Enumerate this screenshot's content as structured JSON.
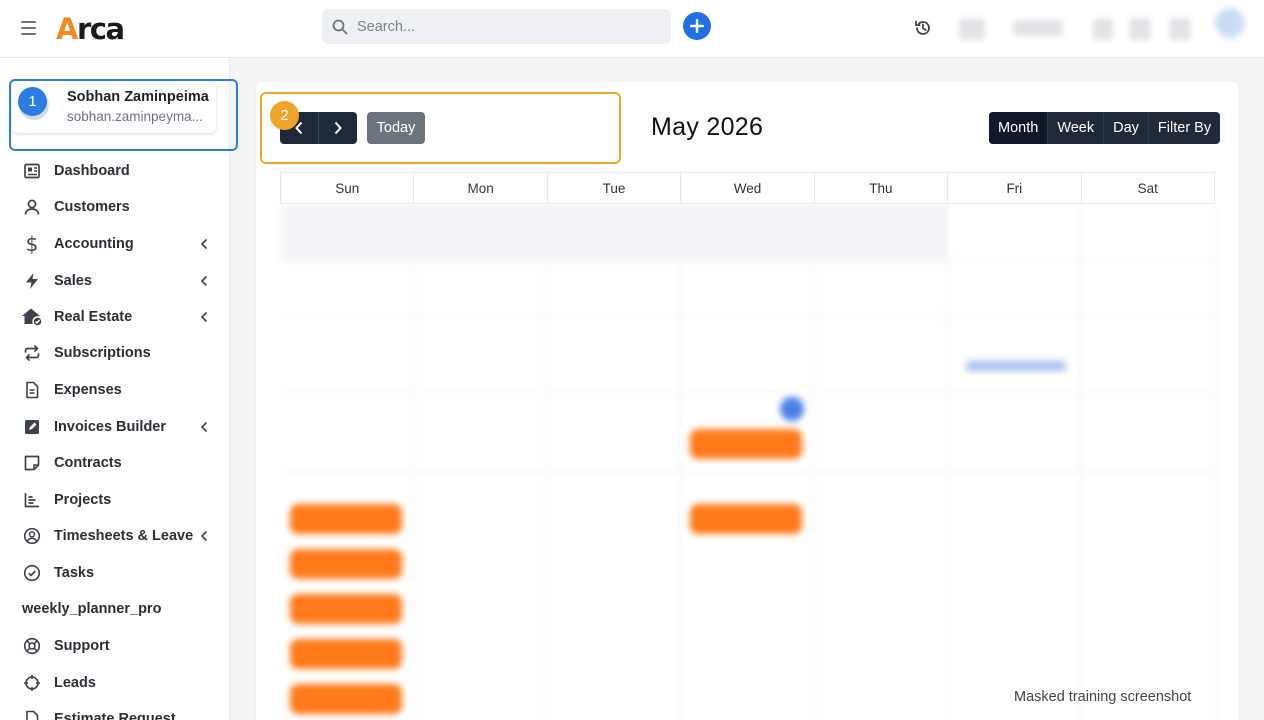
{
  "app": {
    "logo_text_a": "A",
    "logo_text_rest": "rca"
  },
  "search": {
    "placeholder": "Search..."
  },
  "profile": {
    "name": "Sobhan Zaminpeima",
    "email": "sobhan.zaminpeyma..."
  },
  "markers": {
    "one": "1",
    "two": "2"
  },
  "sidebar": {
    "items": [
      {
        "label": "Dashboard",
        "icon": "dashboard-icon",
        "submenu": false
      },
      {
        "label": "Customers",
        "icon": "user-icon",
        "submenu": false
      },
      {
        "label": "Accounting",
        "icon": "dollar-icon",
        "submenu": true
      },
      {
        "label": "Sales",
        "icon": "bolt-icon",
        "submenu": true
      },
      {
        "label": "Real Estate",
        "icon": "house-icon",
        "submenu": true
      },
      {
        "label": "Subscriptions",
        "icon": "repeat-icon",
        "submenu": false
      },
      {
        "label": "Expenses",
        "icon": "document-icon",
        "submenu": false
      },
      {
        "label": "Invoices Builder",
        "icon": "edit-icon",
        "submenu": true
      },
      {
        "label": "Contracts",
        "icon": "note-icon",
        "submenu": false
      },
      {
        "label": "Projects",
        "icon": "chart-icon",
        "submenu": false
      },
      {
        "label": "Timesheets & Leave",
        "icon": "user-circle-icon",
        "submenu": true
      },
      {
        "label": "Tasks",
        "icon": "check-circle-icon",
        "submenu": false
      },
      {
        "label": "weekly_planner_pro",
        "icon": "",
        "submenu": false
      },
      {
        "label": "Support",
        "icon": "lifebuoy-icon",
        "submenu": false
      },
      {
        "label": "Leads",
        "icon": "crosshair-icon",
        "submenu": false
      },
      {
        "label": "Estimate Request",
        "icon": "file-icon",
        "submenu": false
      }
    ]
  },
  "calendar": {
    "today_label": "Today",
    "title": "May 2026",
    "views": [
      "Month",
      "Week",
      "Day",
      "Filter By"
    ],
    "active_view": "Month",
    "weekdays": [
      "Sun",
      "Mon",
      "Tue",
      "Wed",
      "Thu",
      "Fri",
      "Sat"
    ]
  },
  "colors": {
    "accent": "#1f6fe5",
    "event": "#ff7a1a",
    "marker_blue": "#2a7de1",
    "marker_orange": "#f0a52a",
    "dark_button": "#1f2937"
  },
  "watermark": "Masked training screenshot"
}
